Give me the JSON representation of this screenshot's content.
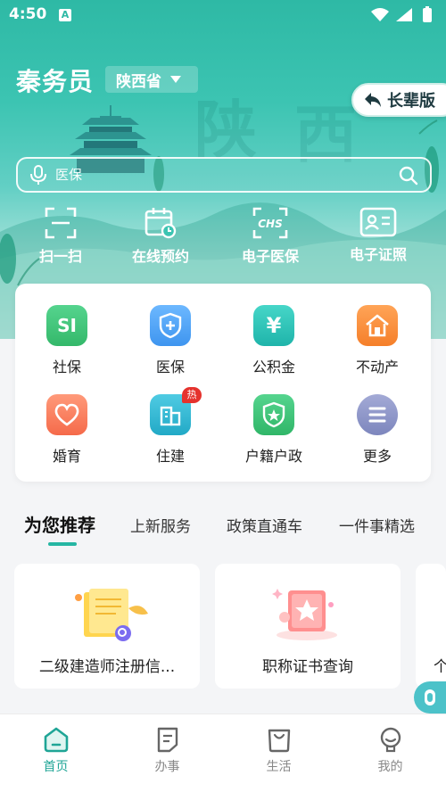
{
  "status_bar": {
    "time": "4:50",
    "notification_letter": "A"
  },
  "header": {
    "user_name": "秦务员",
    "province": "陕西省",
    "elder_mode_label": "长辈版"
  },
  "search": {
    "placeholder": "医保"
  },
  "quick_actions": [
    {
      "label": "扫一扫",
      "icon": "scan-icon"
    },
    {
      "label": "在线预约",
      "icon": "calendar-clock-icon"
    },
    {
      "label": "电子医保",
      "icon": "chs-medical-card-icon"
    },
    {
      "label": "电子证照",
      "icon": "id-card-icon"
    }
  ],
  "services": [
    {
      "label": "社保",
      "icon": "si-social-security-icon",
      "color": "#3cc47a",
      "icon_text": "SI"
    },
    {
      "label": "医保",
      "icon": "medical-shield-icon",
      "color": "#4fa6f5"
    },
    {
      "label": "公积金",
      "icon": "yuan-icon",
      "color": "#2fc4b9",
      "icon_text": "¥"
    },
    {
      "label": "不动产",
      "icon": "house-icon",
      "color": "#fb8c3b"
    },
    {
      "label": "婚育",
      "icon": "heart-icon",
      "color": "#fb7d5a"
    },
    {
      "label": "住建",
      "icon": "building-icon",
      "color": "#32b8d2",
      "badge": "热"
    },
    {
      "label": "户籍户政",
      "icon": "police-badge-icon",
      "color": "#3cc47a"
    },
    {
      "label": "更多",
      "icon": "more-list-icon",
      "color": "#8c95c2"
    }
  ],
  "recommend_tabs": [
    {
      "label": "为您推荐",
      "active": true
    },
    {
      "label": "上新服务",
      "active": false
    },
    {
      "label": "政策直通车",
      "active": false
    },
    {
      "label": "一件事精选",
      "active": false
    }
  ],
  "recommend_cards": [
    {
      "title": "二级建造师注册信...",
      "icon": "certificate-search-illustration"
    },
    {
      "title": "职称证书查询",
      "icon": "star-certificate-illustration"
    },
    {
      "title": "个",
      "icon": ""
    }
  ],
  "bottom_nav": [
    {
      "label": "首页",
      "icon": "home-icon",
      "active": true
    },
    {
      "label": "办事",
      "icon": "document-icon",
      "active": false
    },
    {
      "label": "生活",
      "icon": "shopping-bag-icon",
      "active": false
    },
    {
      "label": "我的",
      "icon": "profile-icon",
      "active": false
    }
  ],
  "colors": {
    "brand": "#2eb9a5",
    "accent": "#1fa596",
    "hot_badge": "#e5322d"
  }
}
